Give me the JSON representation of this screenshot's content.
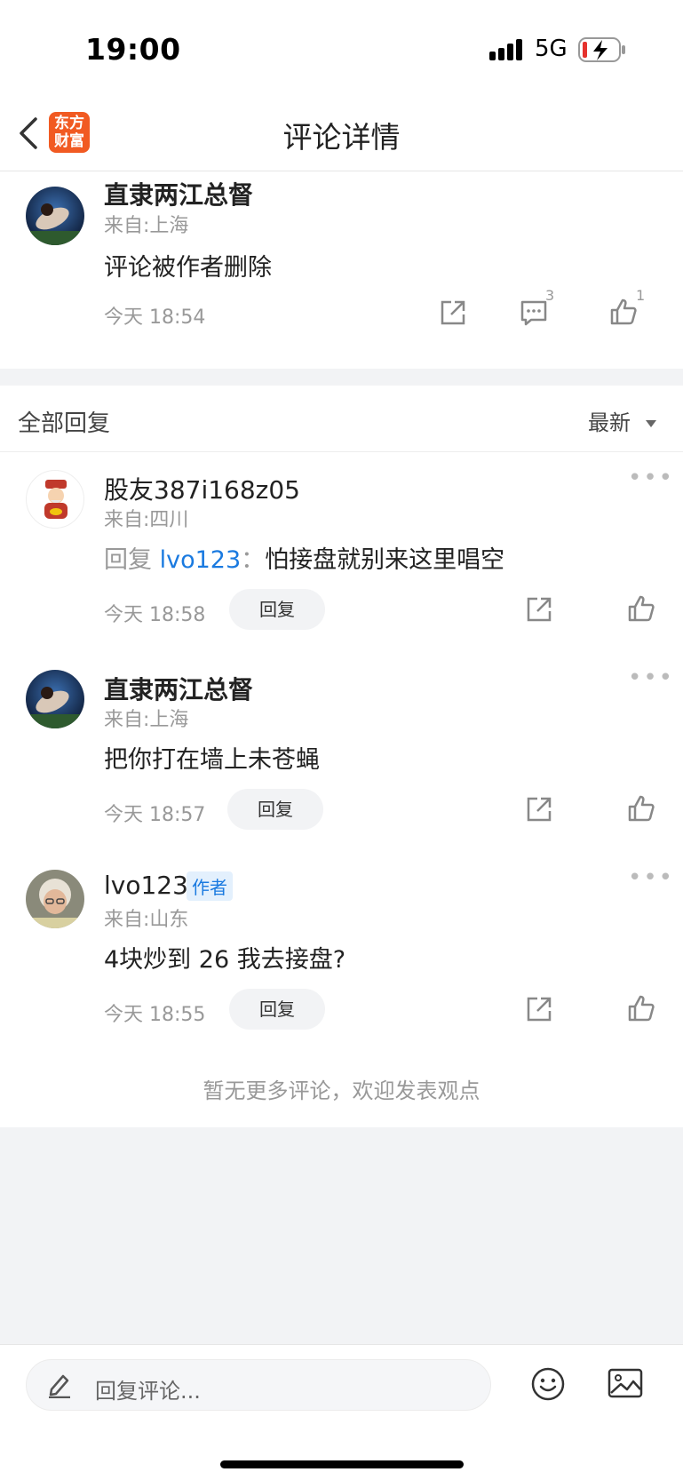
{
  "status": {
    "time": "19:00",
    "network": "5G"
  },
  "nav": {
    "title": "评论详情",
    "logo": "东方财富"
  },
  "main_comment": {
    "author": "直隶两江总督",
    "location": "来自:上海",
    "text": "评论被作者删除",
    "time": "今天 18:54",
    "reply_count": "3",
    "like_count": "1"
  },
  "replies_section": {
    "header": "全部回复",
    "sort_label": "最新",
    "reply_button": "回复",
    "no_more": "暂无更多评论，欢迎发表观点",
    "items": [
      {
        "author": "股友387i168z05",
        "location": "来自:四川",
        "reply_prefix": "回复",
        "reply_to": "lvo123",
        "reply_sep": "：",
        "text": "怕接盘就别来这里唱空",
        "time": "今天 18:58"
      },
      {
        "author": "直隶两江总督",
        "location": "来自:上海",
        "text": "把你打在墙上未苍蝇",
        "time": "今天 18:57"
      },
      {
        "author": "lvo123",
        "badge": "作者",
        "location": "来自:山东",
        "text": "4块炒到 26 我去接盘?",
        "time": "今天 18:55"
      }
    ]
  },
  "bottom_bar": {
    "placeholder": "回复评论..."
  },
  "colors": {
    "accent": "#1a7ae0",
    "brand": "#f15a22"
  }
}
